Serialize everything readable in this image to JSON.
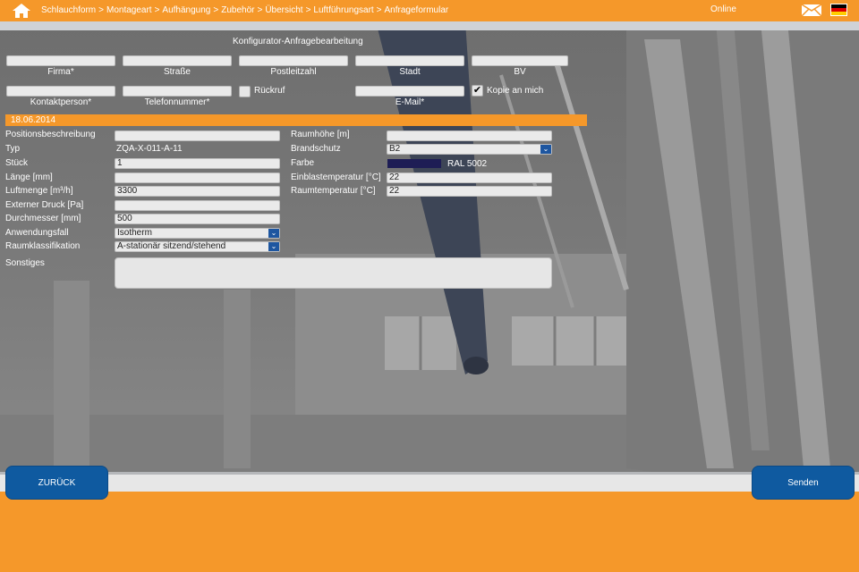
{
  "breadcrumb": [
    "Schlauchform",
    "Montageart",
    "Aufhängung",
    "Zubehör",
    "Übersicht",
    "Luftführungsart",
    "Anfrageformular"
  ],
  "breadcrumb_separator": ">",
  "status": "Online",
  "form": {
    "title": "Konfigurator-Anfragebearbeitung",
    "firma_label": "Firma*",
    "strasse_label": "Straße",
    "plz_label": "Postleitzahl",
    "stadt_label": "Stadt",
    "bv_label": "BV",
    "kontakt_label": "Kontaktperson*",
    "telefon_label": "Telefonnummer*",
    "rueckruf_label": "Rückruf",
    "email_label": "E-Mail*",
    "kopie_label": "Kopie an mich",
    "kopie_checked": "✔",
    "date": "18.06.2014"
  },
  "left_fields": {
    "positionsbeschreibung_label": "Positionsbeschreibung",
    "typ_label": "Typ",
    "typ_value": "ZQA-X-011-A-11",
    "stueck_label": "Stück",
    "stueck_value": "1",
    "laenge_label": "Länge [mm]",
    "luftmenge_label": "Luftmenge [m³/h]",
    "luftmenge_value": "3300",
    "druck_label": "Externer Druck [Pa]",
    "durchmesser_label": "Durchmesser [mm]",
    "durchmesser_value": "500",
    "anwendungsfall_label": "Anwendungsfall",
    "anwendungsfall_value": "Isotherm",
    "raumklass_label": "Raumklassifikation",
    "raumklass_value": "A-stationär sitzend/stehend",
    "sonstiges_label": "Sonstiges"
  },
  "right_fields": {
    "raumhoehe_label": "Raumhöhe [m]",
    "brandschutz_label": "Brandschutz",
    "brandschutz_value": "B2",
    "farbe_label": "Farbe",
    "farbe_value": "RAL 5002",
    "farbe_color": "#1e1d55",
    "einblas_label": "Einblastemperatur [°C]",
    "einblas_value": "22",
    "raumtemp_label": "Raumtemperatur [°C]",
    "raumtemp_value": "22"
  },
  "buttons": {
    "back": "ZURÜCK",
    "send": "Senden"
  },
  "colors": {
    "accent": "#f5982a",
    "button": "#0f5aa0"
  },
  "icons": [
    "home-icon",
    "mail-icon",
    "german-flag-icon",
    "chevron-down-icon"
  ]
}
